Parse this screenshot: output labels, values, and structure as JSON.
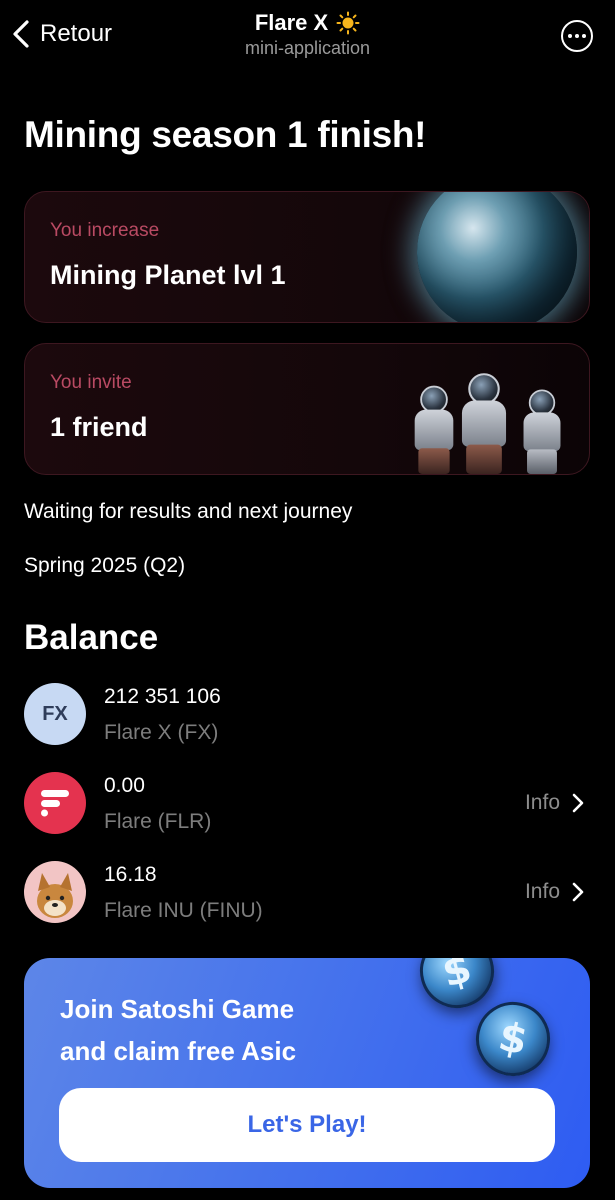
{
  "header": {
    "back_label": "Retour",
    "app_title": "Flare X",
    "app_subtitle": "mini-application",
    "title_icon": "sun-icon",
    "more_icon": "more-icon"
  },
  "main": {
    "heading": "Mining season 1 finish!",
    "cards": [
      {
        "label": "You increase",
        "value": "Mining Planet lvl 1",
        "image": "planet-image"
      },
      {
        "label": "You invite",
        "value": "1 friend",
        "image": "astronauts-image"
      }
    ],
    "status_text": "Waiting for results and next journey",
    "season_text": "Spring 2025 (Q2)"
  },
  "balance": {
    "heading": "Balance",
    "tokens": [
      {
        "icon_text": "FX",
        "amount": "212 351 106",
        "name": "Flare X (FX)",
        "info": ""
      },
      {
        "icon_text": "",
        "amount": "0.00",
        "name": "Flare (FLR)",
        "info": "Info"
      },
      {
        "icon_text": "",
        "amount": "16.18",
        "name": "Flare INU (FINU)",
        "info": "Info"
      }
    ]
  },
  "promo": {
    "line1": "Join Satoshi Game",
    "line2": "and claim free Asic",
    "button_label": "Let's Play!",
    "coin_symbol": "$"
  },
  "colors": {
    "background": "#000000",
    "card_label": "#b94a63",
    "promo_bg": "#4774ec",
    "button_text": "#3a66e6",
    "flr_icon": "#e4334f",
    "fx_icon": "#c7d9f3"
  }
}
